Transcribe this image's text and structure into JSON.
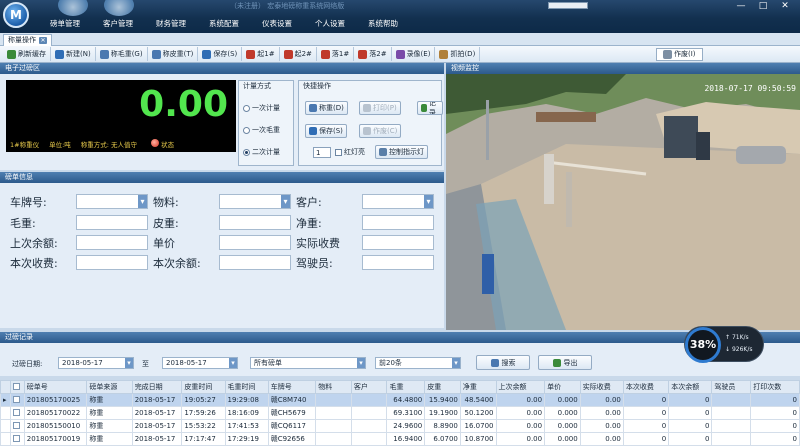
{
  "titlebar": {
    "app_title": "（未注册）  宏泰地磅称重系统网络版",
    "menu": [
      "磅单管理",
      "客户管理",
      "财务管理",
      "系统配置",
      "仪表设置",
      "个人设置",
      "系统帮助"
    ],
    "controls": [
      "—",
      "□",
      "✕"
    ]
  },
  "tabs": {
    "active": "称量操作"
  },
  "toolbar": {
    "buttons": [
      {
        "label": "刷新缓存",
        "icon": "refresh-icon",
        "color": "#3a8a3a"
      },
      {
        "label": "新建(N)",
        "icon": "new-icon",
        "color": "#2f6db5"
      },
      {
        "label": "称毛重(G)",
        "icon": "weigh-gross-icon",
        "color": "#4a78b0"
      },
      {
        "label": "称皮重(T)",
        "icon": "weigh-tare-icon",
        "color": "#4a78b0"
      },
      {
        "label": "保存(S)",
        "icon": "save-icon",
        "color": "#2f6db5"
      },
      {
        "label": "起1#",
        "icon": "gate-up-icon",
        "color": "#c0392b"
      },
      {
        "label": "起2#",
        "icon": "gate-up-icon",
        "color": "#c0392b"
      },
      {
        "label": "落1#",
        "icon": "gate-down-icon",
        "color": "#c0392b"
      },
      {
        "label": "落2#",
        "icon": "gate-down-icon",
        "color": "#c0392b"
      },
      {
        "label": "录像(E)",
        "icon": "record-icon",
        "color": "#7a4ba8"
      },
      {
        "label": "抓拍(D)",
        "icon": "capture-icon",
        "color": "#b0803a"
      }
    ],
    "stop_label": "作废(I)"
  },
  "scale": {
    "section_title": "电子过磅区",
    "value": "0.00",
    "status": {
      "meter": "1#称重仪",
      "unit": "单位:吨",
      "mode": "称重方式: 无人值守",
      "state": "状态"
    }
  },
  "measure_mode": {
    "title": "计量方式",
    "options": [
      {
        "label": "一次计量",
        "selected": false
      },
      {
        "label": "一次毛重",
        "selected": false
      },
      {
        "label": "二次计量",
        "selected": true
      }
    ]
  },
  "quick_ops": {
    "title": "快捷操作",
    "weigh": "称重(D)",
    "print": "打印(P)",
    "save": "保存(S)",
    "cancel": "作废(C)",
    "light_value": "1",
    "light_label": "红灯亮",
    "control_label": "控制指示灯",
    "extra": "记录"
  },
  "form": {
    "section_title": "磅单信息",
    "labels": {
      "plate": "车牌号:",
      "material": "物料:",
      "customer": "客户:",
      "gross": "毛重:",
      "tare": "皮重:",
      "net": "净重:",
      "last_balance": "上次余额:",
      "unit_price": "单价",
      "actual_received": "实际收费",
      "current_charge": "本次收费:",
      "current_balance": "本次余额:",
      "driver": "驾驶员:"
    }
  },
  "video": {
    "section_title": "视频监控",
    "timestamp": "2018-07-17  09:50:59"
  },
  "records": {
    "section_title": "过磅记录",
    "date_label": "过磅日期:",
    "start_date": "2018-05-17",
    "to_label": "至",
    "end_date": "2018-05-17",
    "type_select": "所有磅单",
    "count_select": "前20条",
    "search_button": "搜索",
    "export_button": "导出",
    "columns": [
      "",
      "磅单号",
      "磅单来源",
      "完成日期",
      "皮重时间",
      "毛重时间",
      "车牌号",
      "物料",
      "客户",
      "毛重",
      "皮重",
      "净重",
      "上次余额",
      "单价",
      "实际收费",
      "本次收费",
      "本次余额",
      "驾驶员",
      "打印次数"
    ],
    "rows": [
      [
        "",
        "201805170025",
        "称重",
        "2018-05-17",
        "19:05:27",
        "19:29:08",
        "赣C8M740",
        "",
        "",
        "64.4800",
        "15.9400",
        "48.5400",
        "0.00",
        "0.000",
        "0.00",
        "0",
        "0",
        "",
        "0"
      ],
      [
        "",
        "201805170022",
        "称重",
        "2018-05-17",
        "17:59:26",
        "18:16:09",
        "赣CH5679",
        "",
        "",
        "69.3100",
        "19.1900",
        "50.1200",
        "0.00",
        "0.000",
        "0.00",
        "0",
        "0",
        "",
        "0"
      ],
      [
        "",
        "201805150010",
        "称重",
        "2018-05-17",
        "15:53:22",
        "17:41:53",
        "赣CQ6117",
        "",
        "",
        "24.9600",
        "8.8900",
        "16.0700",
        "0.00",
        "0.000",
        "0.00",
        "0",
        "0",
        "",
        "0"
      ],
      [
        "",
        "201805170019",
        "称重",
        "2018-05-17",
        "17:17:47",
        "17:29:19",
        "赣C92656",
        "",
        "",
        "16.9400",
        "6.0700",
        "10.8700",
        "0.00",
        "0.000",
        "0.00",
        "0",
        "0",
        "",
        "0"
      ]
    ],
    "selected_row": 0
  },
  "network": {
    "percent": "38%",
    "up": "71K/s",
    "down": "926K/s"
  },
  "colors": {
    "title_bar": "#12304f",
    "panel_header": "#2c5a8c",
    "scale_digits": "#52e64e",
    "accent": "#2f7bd0"
  }
}
